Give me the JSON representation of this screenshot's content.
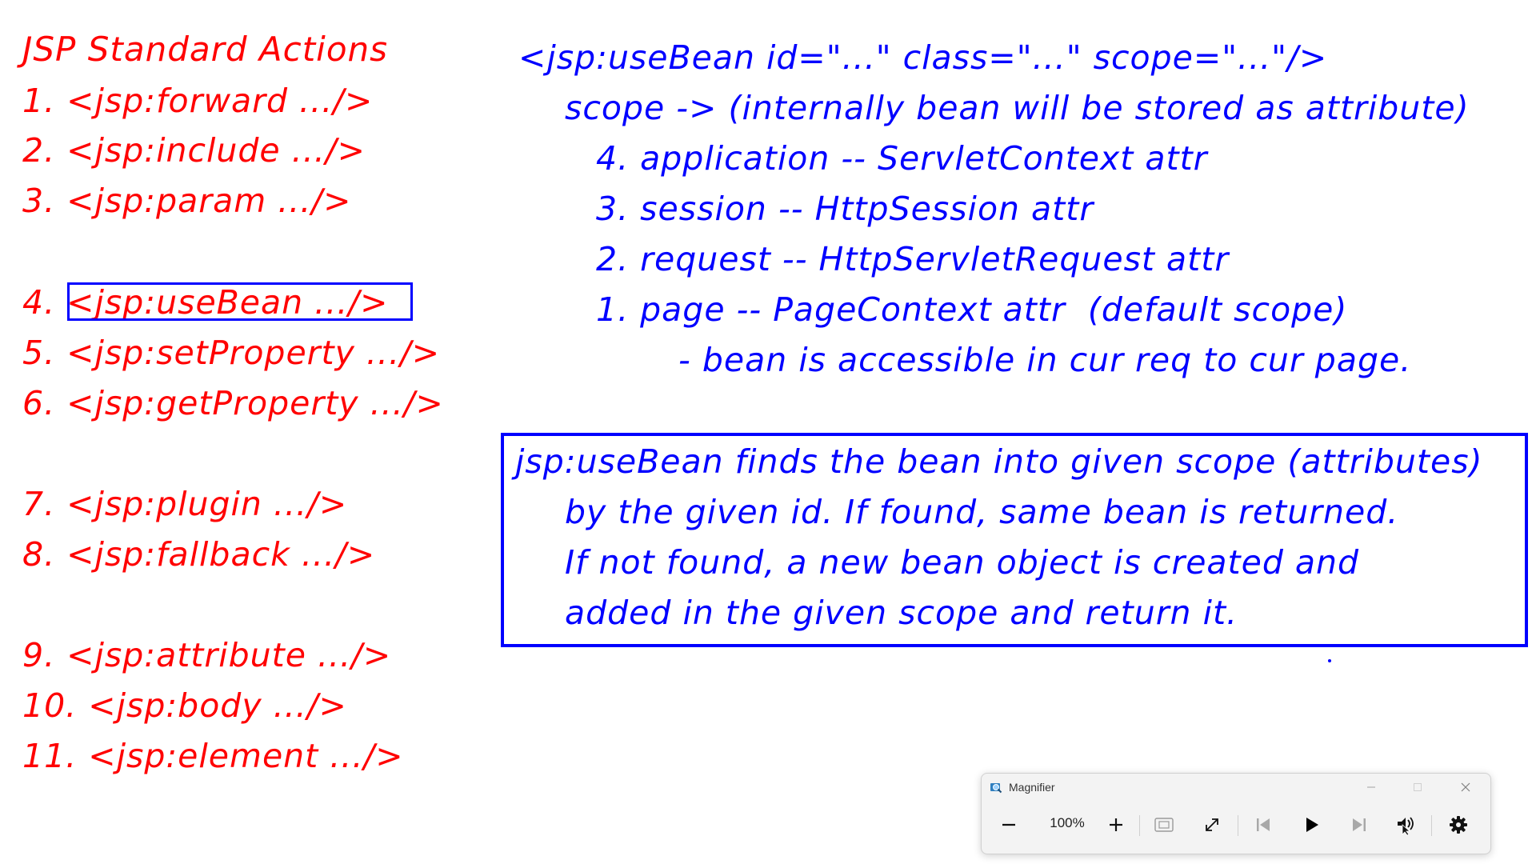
{
  "left_list": {
    "title": "JSP Standard Actions",
    "items": [
      "1. <jsp:forward .../>",
      "2. <jsp:include .../>",
      "3. <jsp:param .../>",
      "4. <jsp:useBean .../>",
      "5. <jsp:setProperty .../>",
      "6. <jsp:getProperty .../>",
      "7. <jsp:plugin .../>",
      "8. <jsp:fallback .../>",
      "9. <jsp:attribute .../>",
      "10. <jsp:body .../>",
      "11. <jsp:element .../>"
    ]
  },
  "right_notes": {
    "syntax": "<jsp:useBean id=\"...\" class=\"...\" scope=\"...\"/>",
    "scope_heading": "scope -> (internally bean will be stored as attribute)",
    "scopes": [
      "4. application -- ServletContext attr",
      "3. session -- HttpSession attr",
      "2. request -- HttpServletRequest attr",
      "1. page -- PageContext attr  (default scope)"
    ],
    "page_note": "- bean is accessible in cur req to cur page."
  },
  "note_box": {
    "lines": [
      "jsp:useBean finds the bean into given scope (attributes)",
      "by the given id. If found, same bean is returned.",
      "If not found, a new bean object is created and",
      "added in the given scope and return it."
    ]
  },
  "magnifier": {
    "title": "Magnifier",
    "zoom": "100%",
    "icons": {
      "app": "magnifier-app-icon",
      "minimize": "minimize-icon",
      "maximize": "maximize-icon",
      "close": "close-icon",
      "zoom_out": "minus-icon",
      "zoom_in": "plus-icon",
      "fit": "fit-screen-icon",
      "expand": "expand-icon",
      "previous": "skip-previous-icon",
      "play": "play-icon",
      "next": "skip-next-icon",
      "read_from_here": "read-from-here-icon",
      "settings": "gear-icon"
    }
  },
  "colors": {
    "red_text": "#ff0000",
    "blue_text": "#0000ff",
    "background": "#ffffff"
  }
}
